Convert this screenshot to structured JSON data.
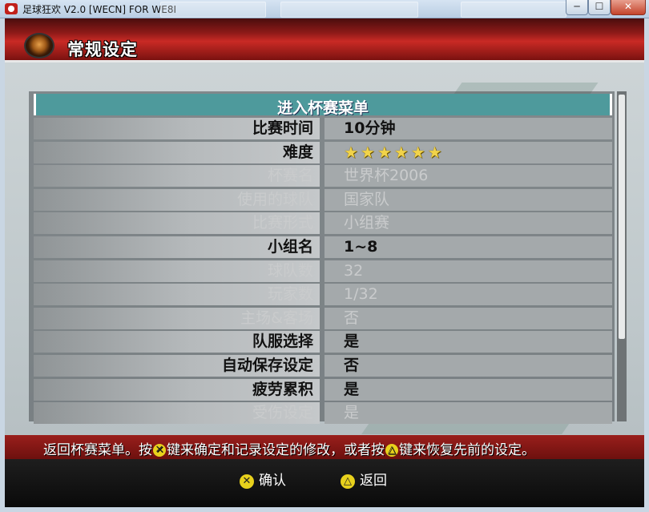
{
  "window": {
    "title": "足球狂欢 V2.0 [WECN] FOR WE8I",
    "controls": {
      "minimize": "─",
      "maximize": "☐",
      "close": "✕"
    }
  },
  "header": {
    "title": "常规设定"
  },
  "menu": {
    "heading": "进入杯赛菜单",
    "rows": [
      {
        "label": "比赛时间",
        "value": "10分钟",
        "enabled": true
      },
      {
        "label": "难度",
        "value": "★★★★★★",
        "enabled": true
      },
      {
        "label": "杯赛名",
        "value": "世界杯2006",
        "enabled": false
      },
      {
        "label": "使用的球队",
        "value": "国家队",
        "enabled": false
      },
      {
        "label": "比赛形式",
        "value": "小组赛",
        "enabled": false
      },
      {
        "label": "小组名",
        "value": "1~8",
        "enabled": true
      },
      {
        "label": "球队数",
        "value": "32",
        "enabled": false
      },
      {
        "label": "玩家数",
        "value": "1/32",
        "enabled": false
      },
      {
        "label": "主场&客场",
        "value": "否",
        "enabled": false
      },
      {
        "label": "队服选择",
        "value": "是",
        "enabled": true
      },
      {
        "label": "自动保存设定",
        "value": "否",
        "enabled": true
      },
      {
        "label": "疲劳累积",
        "value": "是",
        "enabled": true
      },
      {
        "label": "受伤设定",
        "value": "是",
        "enabled": false
      }
    ]
  },
  "hint": {
    "part1": "返回杯赛菜单。按",
    "confirm_glyph": "✕",
    "part2": "键来确定和记录设定的修改，或者按",
    "back_glyph": "△",
    "part3": "键来恢复先前的设定。"
  },
  "footer": {
    "confirm_glyph": "✕",
    "confirm_label": "确认",
    "back_glyph": "△",
    "back_label": "返回"
  },
  "colors": {
    "header_red": "#c92a25",
    "menu_teal": "#4e9a9c",
    "button_yellow": "#e8d11c"
  }
}
